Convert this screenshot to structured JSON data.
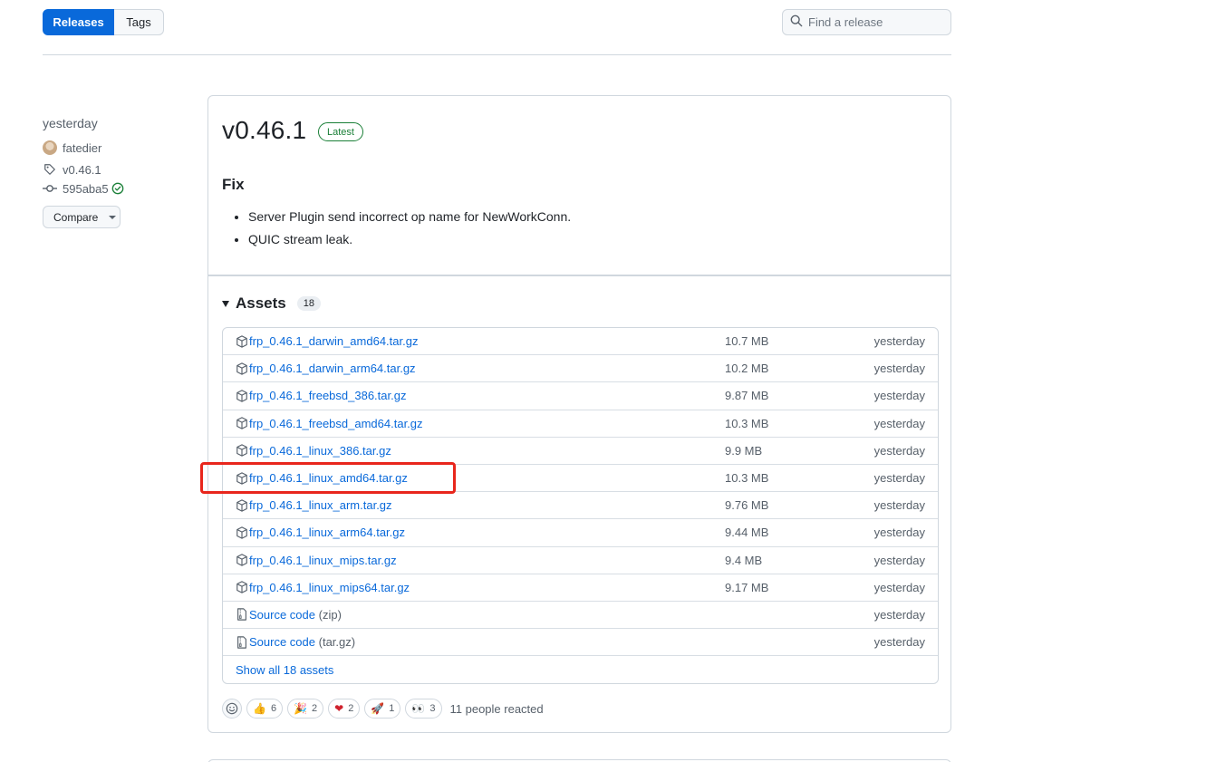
{
  "nav": {
    "releases_label": "Releases",
    "tags_label": "Tags",
    "search_placeholder": "Find a release"
  },
  "meta": {
    "date": "yesterday",
    "author": "fatedier",
    "tag": "v0.46.1",
    "commit": "595aba5",
    "compare_label": "Compare"
  },
  "release": {
    "title": "v0.46.1",
    "badge": "Latest",
    "section": "Fix",
    "notes": [
      "Server Plugin send incorrect op name for NewWorkConn.",
      "QUIC stream leak."
    ]
  },
  "assets": {
    "title": "Assets",
    "count": "18",
    "items": [
      {
        "name": "frp_0.46.1_darwin_amd64.tar.gz",
        "size": "10.7 MB",
        "date": "yesterday"
      },
      {
        "name": "frp_0.46.1_darwin_arm64.tar.gz",
        "size": "10.2 MB",
        "date": "yesterday"
      },
      {
        "name": "frp_0.46.1_freebsd_386.tar.gz",
        "size": "9.87 MB",
        "date": "yesterday"
      },
      {
        "name": "frp_0.46.1_freebsd_amd64.tar.gz",
        "size": "10.3 MB",
        "date": "yesterday"
      },
      {
        "name": "frp_0.46.1_linux_386.tar.gz",
        "size": "9.9 MB",
        "date": "yesterday"
      },
      {
        "name": "frp_0.46.1_linux_amd64.tar.gz",
        "size": "10.3 MB",
        "date": "yesterday"
      },
      {
        "name": "frp_0.46.1_linux_arm.tar.gz",
        "size": "9.76 MB",
        "date": "yesterday"
      },
      {
        "name": "frp_0.46.1_linux_arm64.tar.gz",
        "size": "9.44 MB",
        "date": "yesterday"
      },
      {
        "name": "frp_0.46.1_linux_mips.tar.gz",
        "size": "9.4 MB",
        "date": "yesterday"
      },
      {
        "name": "frp_0.46.1_linux_mips64.tar.gz",
        "size": "9.17 MB",
        "date": "yesterday"
      }
    ],
    "source": [
      {
        "name": "Source code",
        "suffix": "(zip)",
        "date": "yesterday"
      },
      {
        "name": "Source code",
        "suffix": "(tar.gz)",
        "date": "yesterday"
      }
    ],
    "show_all": "Show all 18 assets"
  },
  "reactions": {
    "items": [
      {
        "icon": "thumbs-up-icon",
        "emoji": "👍",
        "count": "6"
      },
      {
        "icon": "party-popper-icon",
        "emoji": "🎉",
        "count": "2"
      },
      {
        "icon": "heart-icon",
        "emoji": "❤",
        "count": "2"
      },
      {
        "icon": "rocket-icon",
        "emoji": "🚀",
        "count": "1"
      },
      {
        "icon": "eyes-icon",
        "emoji": "👀",
        "count": "3"
      }
    ],
    "summary": "11 people reacted"
  },
  "colors": {
    "accent": "#0969da",
    "success": "#1a7f37",
    "highlight": "#e8261c"
  }
}
